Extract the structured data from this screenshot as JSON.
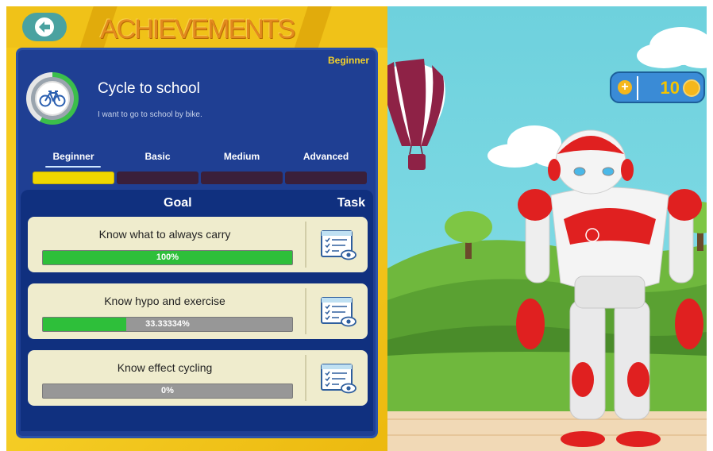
{
  "header": {
    "title": "ACHIEVEMENTS"
  },
  "achievement": {
    "level_tag": "Beginner",
    "name": "Cycle to school",
    "description": "I want to go to school by bike."
  },
  "levels": [
    "Beginner",
    "Basic",
    "Medium",
    "Advanced"
  ],
  "active_level": "Beginner",
  "columns": {
    "goal": "Goal",
    "task": "Task"
  },
  "goals": [
    {
      "label": "Know what to always carry",
      "progress_text": "100%",
      "progress": 1.0
    },
    {
      "label": "Know hypo and exercise",
      "progress_text": "33.33334%",
      "progress": 0.3333334
    },
    {
      "label": "Know effect cycling",
      "progress_text": "0%",
      "progress": 0.0
    }
  ],
  "coins": {
    "count": "10"
  },
  "colors": {
    "panel": "#1f3f93",
    "progress_fill": "#2ebf3a",
    "accent": "#f5c617",
    "robot_accent": "#e02020"
  },
  "icons": [
    "back-arrow-icon",
    "bicycle-icon",
    "task-view-icon",
    "plus-icon",
    "coin-icon"
  ]
}
